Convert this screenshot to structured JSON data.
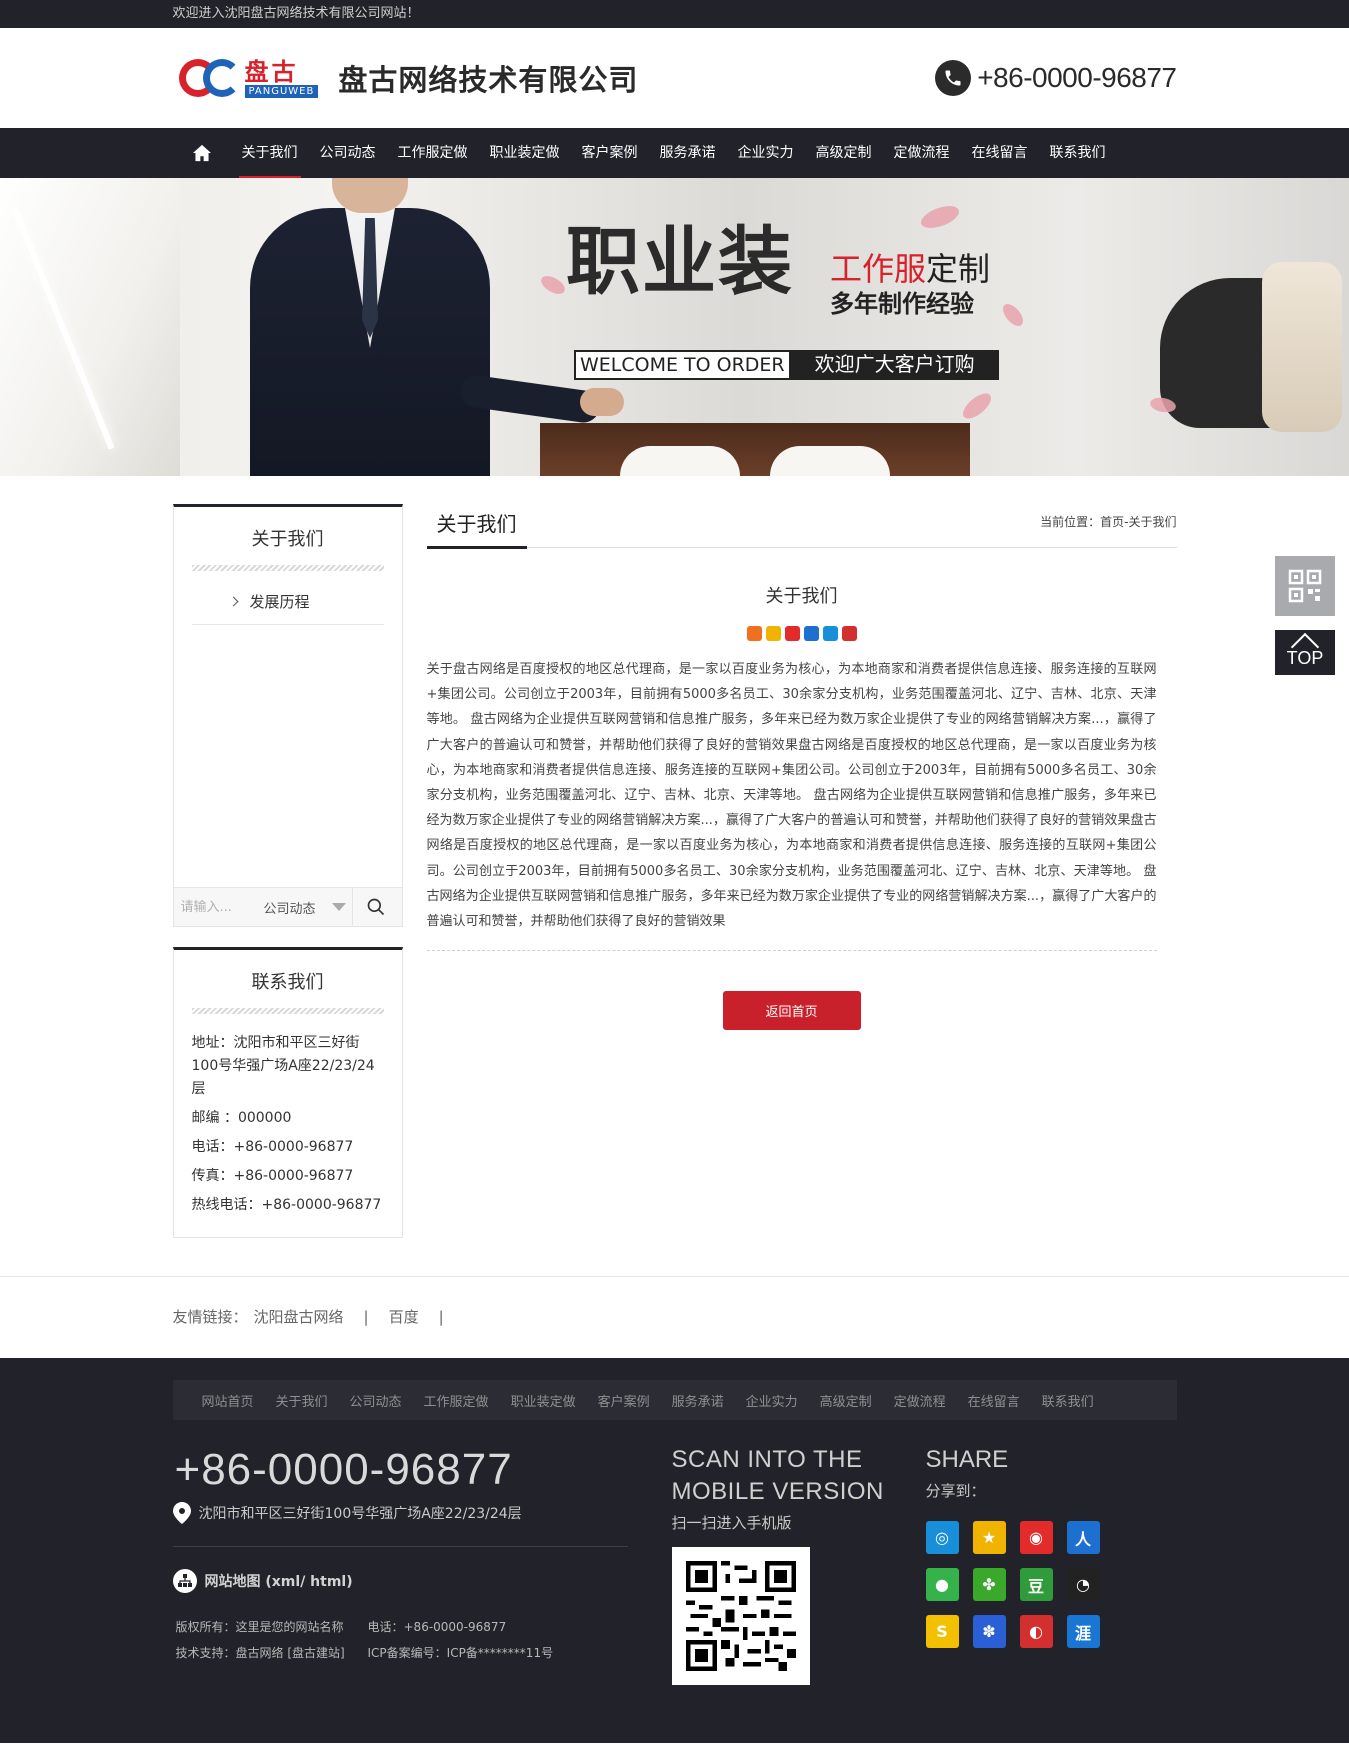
{
  "topbar": {
    "welcome": "欢迎进入沈阳盘古网络技术有限公司网站！"
  },
  "header": {
    "logo_cn": "盘古",
    "logo_en": "PANGUWEB",
    "company_name": "盘古网络技术有限公司",
    "hotline": "+86-0000-96877",
    "phone_icon": "phone-icon"
  },
  "nav": {
    "home_icon": "home-icon",
    "items": [
      "关于我们",
      "公司动态",
      "工作服定做",
      "职业装定做",
      "客户案例",
      "服务承诺",
      "企业实力",
      "高级定制",
      "定做流程",
      "在线留言",
      "联系我们"
    ],
    "active_index": 0
  },
  "banner": {
    "headline": "职业装",
    "sub_red": "工作服",
    "sub_black": "定制",
    "sub2": "多年制作经验",
    "welcome_en": "WELCOME TO ORDER",
    "welcome_cn": "欢迎广大客户订购"
  },
  "sidebar": {
    "about_title": "关于我们",
    "menu": [
      "发展历程"
    ],
    "search": {
      "placeholder": "请输入...",
      "select_value": "公司动态",
      "button_icon": "search-icon"
    },
    "contact_title": "联系我们",
    "contact": [
      "地址：沈阳市和平区三好街100号华强广场A座22/23/24层",
      "邮编 ：000000",
      "电话：+86-0000-96877",
      "传真：+86-0000-96877",
      "热线电话：+86-0000-96877"
    ]
  },
  "content": {
    "section_title": "关于我们",
    "breadcrumb": "当前位置：首页-关于我们",
    "article_title": "关于我们",
    "share_icons": [
      "more-share-icon",
      "qzone-icon",
      "weibo-icon",
      "renren-icon",
      "tencent-weibo-icon",
      "kaixin-icon"
    ],
    "body": "关于盘古网络是百度授权的地区总代理商，是一家以百度业务为核心，为本地商家和消费者提供信息连接、服务连接的互联网+集团公司。公司创立于2003年，目前拥有5000多名员工、30余家分支机构，业务范围覆盖河北、辽宁、吉林、北京、天津等地。 盘古网络为企业提供互联网营销和信息推广服务，多年来已经为数万家企业提供了专业的网络营销解决方案...，赢得了广大客户的普遍认可和赞誉，并帮助他们获得了良好的营销效果盘古网络是百度授权的地区总代理商，是一家以百度业务为核心，为本地商家和消费者提供信息连接、服务连接的互联网+集团公司。公司创立于2003年，目前拥有5000多名员工、30余家分支机构，业务范围覆盖河北、辽宁、吉林、北京、天津等地。 盘古网络为企业提供互联网营销和信息推广服务，多年来已经为数万家企业提供了专业的网络营销解决方案...，赢得了广大客户的普遍认可和赞誉，并帮助他们获得了良好的营销效果盘古网络是百度授权的地区总代理商，是一家以百度业务为核心，为本地商家和消费者提供信息连接、服务连接的互联网+集团公司。公司创立于2003年，目前拥有5000多名员工、30余家分支机构，业务范围覆盖河北、辽宁、吉林、北京、天津等地。 盘古网络为企业提供互联网营销和信息推广服务，多年来已经为数万家企业提供了专业的网络营销解决方案...，赢得了广大客户的普遍认可和赞誉，并帮助他们获得了良好的营销效果",
    "back_button": "返回首页"
  },
  "float": {
    "qr_icon": "qr-code-icon",
    "top_label": "TOP"
  },
  "links": {
    "label": "友情链接：",
    "items": [
      "沈阳盘古网络",
      "百度"
    ]
  },
  "footer": {
    "nav": [
      "网站首页",
      "关于我们",
      "公司动态",
      "工作服定做",
      "职业装定做",
      "客户案例",
      "服务承诺",
      "企业实力",
      "高级定制",
      "定做流程",
      "在线留言",
      "联系我们"
    ],
    "phone": "+86-0000-96877",
    "address": "沈阳市和平区三好街100号华强广场A座22/23/24层",
    "sitemap": "网站地图 (xml/ html)",
    "copyright": "版权所有：这里是您的网站名称",
    "tel": "电话：+86-0000-96877",
    "support": "技术支持：盘古网络 [盘古建站]",
    "icp": "ICP备案编号：ICP备********11号",
    "scan_title_1": "SCAN INTO THE",
    "scan_title_2": "MOBILE VERSION",
    "scan_sub": "扫一扫进入手机版",
    "share_title": "SHARE",
    "share_sub": "分享到：",
    "share_icons": [
      "tencent-weibo-icon",
      "qzone-icon",
      "weibo-icon",
      "renren-icon",
      "wechat-icon",
      "kaixin-icon",
      "douban-icon",
      "qq-icon",
      "sohu-icon",
      "baidu-icon",
      "netease-icon",
      "huiyou-icon"
    ],
    "share_colors": [
      "#1a8fd9",
      "#f0b400",
      "#e42b2b",
      "#1d6fd0",
      "#36b24a",
      "#3aa82a",
      "#2f9b3a",
      "#222222",
      "#f3c000",
      "#2a5fd6",
      "#d32f2f",
      "#1976d2"
    ]
  }
}
